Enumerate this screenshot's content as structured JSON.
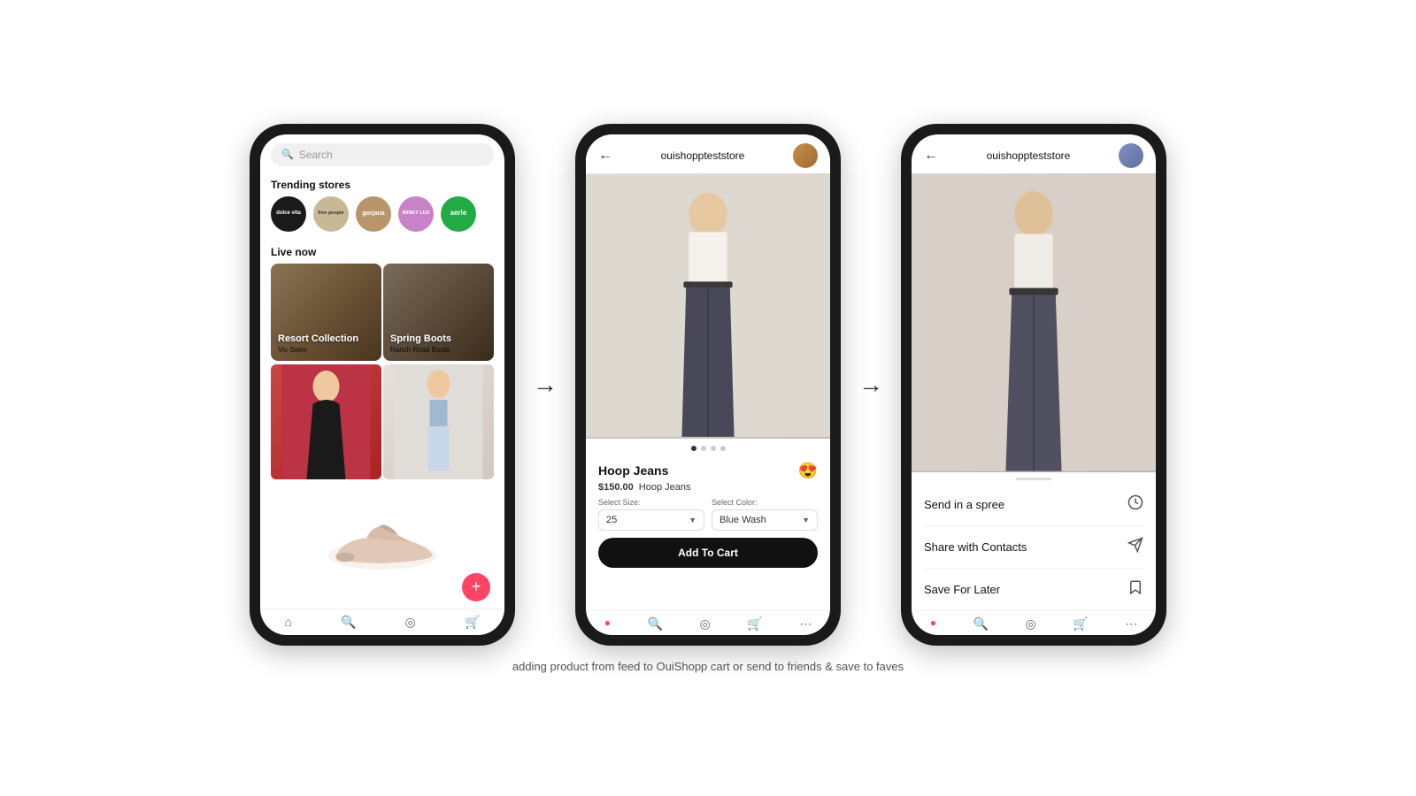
{
  "page": {
    "caption": "adding product from feed to OuiShopp cart or send to friends & save to faves"
  },
  "phone1": {
    "search_placeholder": "Search",
    "trending_title": "Trending stores",
    "live_title": "Live now",
    "stores": [
      {
        "name": "dolce vita",
        "color": "sc-black"
      },
      {
        "name": "free people",
        "color": "sc-cream"
      },
      {
        "name": "gorjana",
        "color": "sc-tan"
      },
      {
        "name": "WINKY LUX",
        "color": "sc-pink"
      },
      {
        "name": "aerie",
        "color": "sc-green"
      }
    ],
    "live_cards": [
      {
        "title": "Resort Collection",
        "sub": "Vix Swim",
        "color": "lc-dark"
      },
      {
        "title": "Spring Boots",
        "sub": "Ranch Road Boots",
        "color": "lc-brown"
      }
    ],
    "fab_icon": "+"
  },
  "phone2": {
    "store_name": "ouishoppteststore",
    "back_icon": "←",
    "product_name": "Hoop Jeans",
    "price": "$150.00",
    "price_label": "Hoop Jeans",
    "emoji": "😍",
    "select_size_label": "Select Size:",
    "select_color_label": "Select Color:",
    "size_value": "25",
    "color_value": "Blue Wash",
    "atc_label": "Add To Cart",
    "dots": [
      {
        "active": true
      },
      {
        "active": false
      },
      {
        "active": false
      },
      {
        "active": false
      }
    ]
  },
  "phone3": {
    "store_name": "ouishoppteststore",
    "back_icon": "←",
    "options": [
      {
        "label": "Send in a spree",
        "icon": "⏱"
      },
      {
        "label": "Share with Contacts",
        "icon": "✈"
      },
      {
        "label": "Save For Later",
        "icon": "🔖"
      }
    ]
  }
}
